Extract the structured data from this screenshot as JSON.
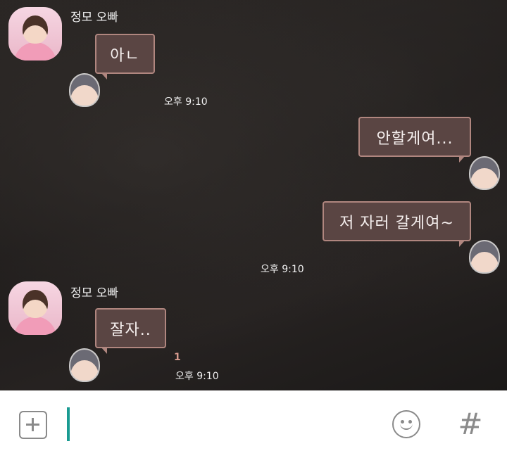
{
  "colors": {
    "bubble_bg": "#5a4543",
    "bubble_border": "#b0867f",
    "cursor": "#1a9b92",
    "unread": "#d79a8e",
    "icon_gray": "#8a8a8a"
  },
  "messages": [
    {
      "sender": "정모 오빠",
      "text": "아ㄴ",
      "time": "오후 9:10"
    },
    {
      "sender": "",
      "text": "안할게여...",
      "time": ""
    },
    {
      "sender": "",
      "text": "저 자러 갈게여~",
      "time": "오후 9:10"
    },
    {
      "sender": "정모 오빠",
      "text": "잘자..",
      "time": "오후 9:10",
      "unread": "1"
    }
  ],
  "input_bar": {
    "plus_icon": "plus-square-icon",
    "emoji_icon": "smiley-icon",
    "hash_icon": "hash-icon",
    "hash_symbol": "#"
  }
}
